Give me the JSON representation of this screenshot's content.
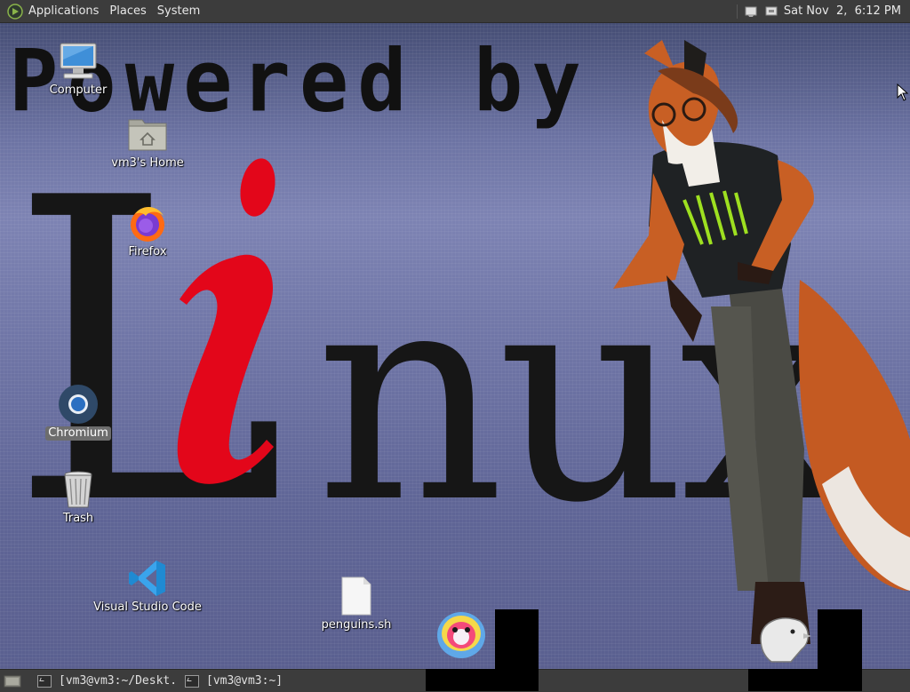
{
  "top_panel": {
    "menus": [
      "Applications",
      "Places",
      "System"
    ],
    "clock": "Sat Nov  2,  6:12 PM"
  },
  "wallpaper": {
    "headline": "Powered by",
    "logo_text_main": "L",
    "logo_text_i": "i",
    "logo_text_rest": "nux"
  },
  "desktop_icons": [
    {
      "label": "Computer",
      "icon": "computer-icon"
    },
    {
      "label": "vm3's Home",
      "icon": "home-folder-icon"
    },
    {
      "label": "Firefox",
      "icon": "firefox-icon"
    },
    {
      "label": "Chromium",
      "icon": "chromium-icon",
      "selected": true
    },
    {
      "label": "Trash",
      "icon": "trash-icon"
    },
    {
      "label": "Visual Studio Code",
      "icon": "vscode-icon"
    },
    {
      "label": "penguins.sh",
      "icon": "script-file-icon"
    }
  ],
  "taskbar": {
    "tasks": [
      {
        "label": "[vm3@vm3:~/Deskt...",
        "icon": "terminal-icon"
      },
      {
        "label": "[vm3@vm3:~]",
        "icon": "terminal-icon"
      }
    ]
  },
  "colors": {
    "panel": "#3c3c3c",
    "wallpaper_top": "#454d74",
    "wallpaper_mid": "#7d83b3",
    "linux_red": "#e3061a",
    "linux_black": "#161616"
  }
}
